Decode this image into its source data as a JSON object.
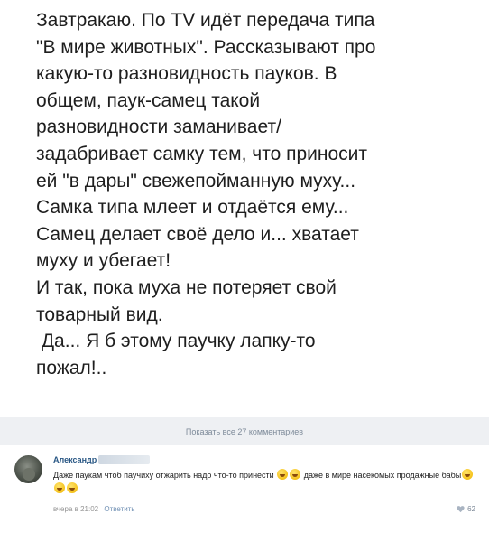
{
  "post": {
    "lines": [
      "Завтракаю. По TV идёт передача типа",
      "\"В мире животных\". Рассказывают про",
      "какую-то разновидность пауков. В",
      "общем, паук-самец такой",
      "разновидности заманивает/",
      "задабривает самку тем, что приносит",
      "ей \"в дары\" свежепойманную муху...",
      "Самка типа млеет и отдаётся ему...",
      "Самец делает своё дело и... хватает",
      "муху и убегает!",
      "И так, пока муха не потеряет свой",
      "товарный вид.",
      " Да... Я б этому паучку лапку-то",
      "пожал!.."
    ]
  },
  "show_comments_label": "Показать все 27 комментариев",
  "comment": {
    "author": "Александр",
    "text_part1": "Даже паукам чтоб паучиху отжарить надо что-то принести",
    "text_part2": "даже в мире насекомых продажные бабы",
    "emoji_icon": "rolling-on-floor-laughing-emoji",
    "timestamp": "вчера в 21:02",
    "reply_label": "Ответить",
    "likes": "62"
  },
  "colors": {
    "link": "#2a5885",
    "muted": "#939393",
    "bar_bg": "#eef0f3"
  }
}
